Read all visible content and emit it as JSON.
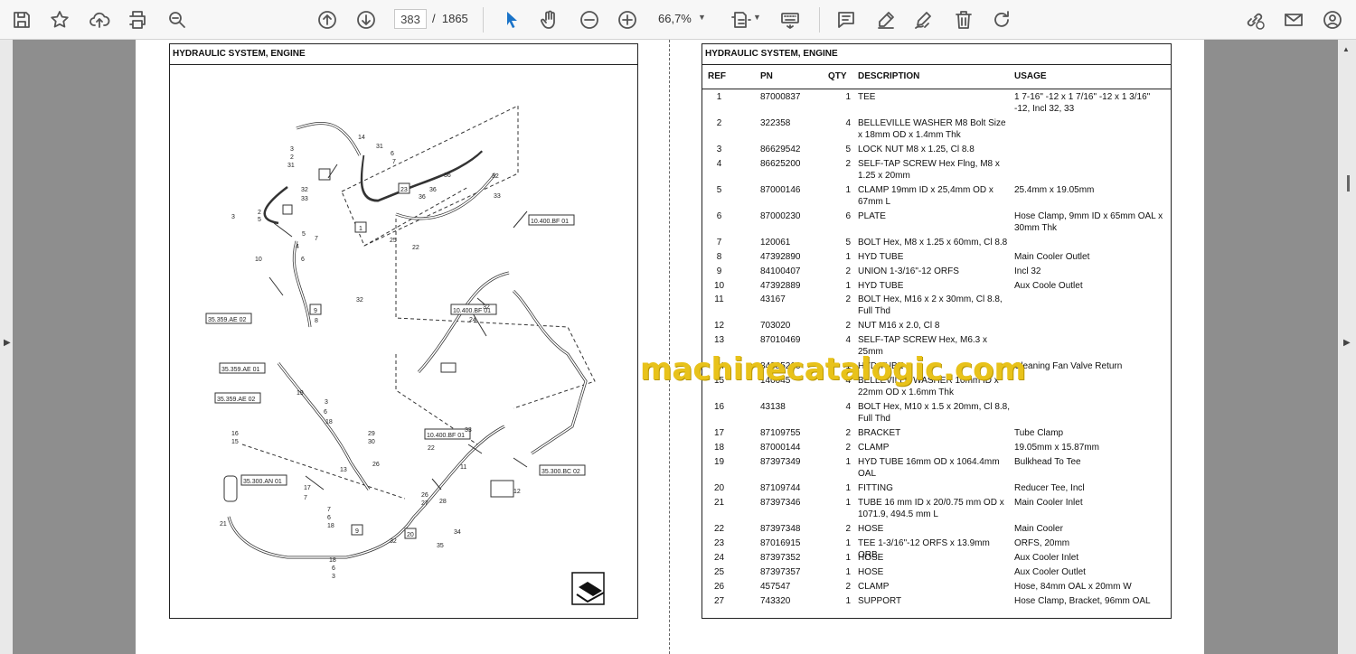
{
  "toolbar": {
    "page_current": "383",
    "page_separator": "/",
    "page_total": "1865",
    "zoom": "66,7%"
  },
  "icons": [
    "save-icon",
    "bookmark-star-icon",
    "upload-cloud-icon",
    "print-icon",
    "zoom-search-icon",
    "page-up-icon",
    "page-down-icon",
    "select-cursor-icon",
    "hand-tool-icon",
    "zoom-out-icon",
    "zoom-in-icon",
    "fit-page-icon",
    "keyboard-icon",
    "comment-icon",
    "highlight-pen-icon",
    "sign-icon",
    "delete-icon",
    "rotate-icon",
    "link-icon",
    "mail-icon",
    "account-icon"
  ],
  "left_page": {
    "title": "HYDRAULIC SYSTEM, ENGINE",
    "callouts": [
      {
        "t": "35.359.AE 02"
      },
      {
        "t": "35.359.AE 01"
      },
      {
        "t": "35.359.AE 02"
      },
      {
        "t": "10.400.BF 01"
      },
      {
        "t": "10.400.BF 01"
      },
      {
        "t": "10.400.BF 01"
      },
      {
        "t": "35.300.AN 01"
      },
      {
        "t": "35.300.BC 02"
      }
    ],
    "boxed_numbers": [
      "23",
      "1",
      "9",
      "9",
      "20"
    ]
  },
  "right_page": {
    "title": "HYDRAULIC SYSTEM, ENGINE",
    "columns": [
      "REF",
      "PN",
      "QTY",
      "DESCRIPTION",
      "USAGE"
    ],
    "rows": [
      {
        "ref": "1",
        "pn": "87000837",
        "qty": "1",
        "desc": "TEE",
        "usage": "1 7-16\" -12 x 1 7/16\" -12 x 1 3/16\" -12, Incl 32, 33"
      },
      {
        "ref": "2",
        "pn": "322358",
        "qty": "4",
        "desc": "BELLEVILLE WASHER M8 Bolt Size x 18mm OD x 1.4mm Thk",
        "usage": ""
      },
      {
        "ref": "3",
        "pn": "86629542",
        "qty": "5",
        "desc": "LOCK NUT M8 x 1.25, Cl 8.8",
        "usage": ""
      },
      {
        "ref": "4",
        "pn": "86625200",
        "qty": "2",
        "desc": "SELF-TAP SCREW Hex Flng, M8 x 1.25 x 20mm",
        "usage": ""
      },
      {
        "ref": "5",
        "pn": "87000146",
        "qty": "1",
        "desc": "CLAMP 19mm ID x 25,4mm OD x 67mm L",
        "usage": "25.4mm x 19.05mm"
      },
      {
        "ref": "6",
        "pn": "87000230",
        "qty": "6",
        "desc": "PLATE",
        "usage": "Hose Clamp, 9mm ID x 65mm OAL x 30mm Thk"
      },
      {
        "ref": "7",
        "pn": "120061",
        "qty": "5",
        "desc": "BOLT Hex, M8 x 1.25 x 60mm, Cl 8.8",
        "usage": ""
      },
      {
        "ref": "8",
        "pn": "47392890",
        "qty": "1",
        "desc": "HYD TUBE",
        "usage": "Main Cooler Outlet"
      },
      {
        "ref": "9",
        "pn": "84100407",
        "qty": "2",
        "desc": "UNION 1-3/16\"-12 ORFS",
        "usage": "Incl 32"
      },
      {
        "ref": "10",
        "pn": "47392889",
        "qty": "1",
        "desc": "HYD TUBE",
        "usage": "Aux Coole Outlet"
      },
      {
        "ref": "11",
        "pn": "43167",
        "qty": "2",
        "desc": "BOLT Hex, M16 x 2 x 30mm, Cl 8.8, Full Thd",
        "usage": ""
      },
      {
        "ref": "12",
        "pn": "703020",
        "qty": "2",
        "desc": "NUT M16 x 2.0, Cl 8",
        "usage": ""
      },
      {
        "ref": "13",
        "pn": "87010469",
        "qty": "4",
        "desc": "SELF-TAP SCREW Hex, M6.3 x 25mm",
        "usage": ""
      },
      {
        "ref": "14",
        "pn": "84385216",
        "qty": "1",
        "desc": "HYD TUBE",
        "usage": "Cleaning Fan Valve Return"
      },
      {
        "ref": "15",
        "pn": "140045",
        "qty": "4",
        "desc": "BELLEVILLE WASHER 10mm ID x 22mm OD x 1.6mm Thk",
        "usage": ""
      },
      {
        "ref": "16",
        "pn": "43138",
        "qty": "4",
        "desc": "BOLT Hex, M10 x 1.5 x 20mm, Cl 8.8, Full Thd",
        "usage": ""
      },
      {
        "ref": "17",
        "pn": "87109755",
        "qty": "2",
        "desc": "BRACKET",
        "usage": "Tube Clamp"
      },
      {
        "ref": "18",
        "pn": "87000144",
        "qty": "2",
        "desc": "CLAMP",
        "usage": "19.05mm x 15.87mm"
      },
      {
        "ref": "19",
        "pn": "87397349",
        "qty": "1",
        "desc": "HYD TUBE 16mm OD x 1064.4mm OAL",
        "usage": "Bulkhead To Tee"
      },
      {
        "ref": "20",
        "pn": "87109744",
        "qty": "1",
        "desc": "FITTING",
        "usage": "Reducer Tee, Incl"
      },
      {
        "ref": "21",
        "pn": "87397346",
        "qty": "1",
        "desc": "TUBE 16 mm ID x 20/0.75 mm OD x 1071.9, 494.5 mm L",
        "usage": "Main Cooler Inlet"
      },
      {
        "ref": "22",
        "pn": "87397348",
        "qty": "2",
        "desc": "HOSE",
        "usage": "Main Cooler"
      },
      {
        "ref": "23",
        "pn": "87016915",
        "qty": "1",
        "desc": "TEE 1-3/16\"-12 ORFS x 13.9mm ORB",
        "usage": "ORFS, 20mm"
      },
      {
        "ref": "24",
        "pn": "87397352",
        "qty": "1",
        "desc": "HOSE",
        "usage": "Aux Cooler Inlet"
      },
      {
        "ref": "25",
        "pn": "87397357",
        "qty": "1",
        "desc": "HOSE",
        "usage": "Aux Cooler Outlet"
      },
      {
        "ref": "26",
        "pn": "457547",
        "qty": "2",
        "desc": "CLAMP",
        "usage": "Hose, 84mm OAL x 20mm W"
      },
      {
        "ref": "27",
        "pn": "743320",
        "qty": "1",
        "desc": "SUPPORT",
        "usage": "Hose Clamp, Bracket, 96mm OAL"
      }
    ]
  },
  "watermark": "machinecatalogic.com"
}
